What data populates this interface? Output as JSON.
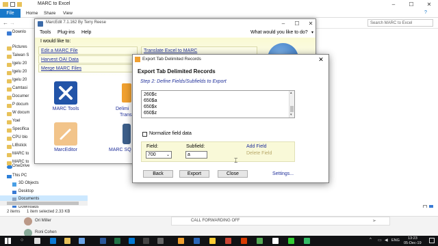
{
  "explorer": {
    "title": "MARC to Excel",
    "ribbon": {
      "file": "File",
      "home": "Home",
      "share": "Share",
      "view": "View"
    },
    "search_placeholder": "Search MARC to Excel",
    "nav_items": [
      "Downlo",
      "Pictures",
      "Taiwan S",
      "Igelu 20",
      "Igelu 20",
      "Igelu 20",
      "Camtasi",
      "Documer",
      "P docum",
      "W docum",
      "Yoel",
      "Specifica",
      "CPU blo",
      "LIBstick",
      "MARC to",
      "MARC to"
    ],
    "onedrive": "OneDrive",
    "this_pc": "This PC",
    "objects3d": "3D Objects",
    "desktop": "Desktop",
    "documents": "Documents",
    "downloads": "Downloads",
    "status": {
      "items": "2 items",
      "selected": "1 item selected  2.33 KB"
    }
  },
  "outlook": {
    "sender": "Ori Miller",
    "call_text": "CALL FORWARDING OFF",
    "second_sender": "Roni Cohen"
  },
  "marcedit": {
    "title": "MarcEdit 7.1.162 By Terry Reese",
    "menu": {
      "tools": "Tools",
      "plugins": "Plug-ins",
      "help": "Help"
    },
    "whats_next": "What would you like to do?",
    "i_would_like": "I would like to:",
    "links_left": [
      "Edit a MARC File",
      "Harvest OAI Data",
      "Merge MARC Files"
    ],
    "link_right": "Translate Excel to MARC",
    "tiles": {
      "tools": "MARC Tools",
      "editor": "MarcEditor",
      "delim": "Delimi",
      "delim2": "Trans",
      "sql": "MARC SQ"
    }
  },
  "dialog": {
    "title": "Export Tab Delimited Records",
    "heading": "Export Tab Delimited Records",
    "step": "Step 2:  Define Fields/Subfields to Export",
    "list": [
      "260$c",
      "650$a",
      "650$x",
      "650$z"
    ],
    "normalize_label": "Normalize field data",
    "field_label": "Field:",
    "field_value": "700",
    "subfield_label": "Subfield:",
    "subfield_value": "a",
    "add_field": "Add Field",
    "delete_field": "Delete Field",
    "back": "Back",
    "export": "Export",
    "close": "Close",
    "settings": "Settings..."
  },
  "taskbar": {
    "lang": "ENG",
    "time": "13:23",
    "date": "05-Dec-19"
  },
  "colors": {
    "accent": "#1979ca",
    "link": "#1f2f9a",
    "panel": "#f9f9d8",
    "taskbar": "#111214"
  }
}
